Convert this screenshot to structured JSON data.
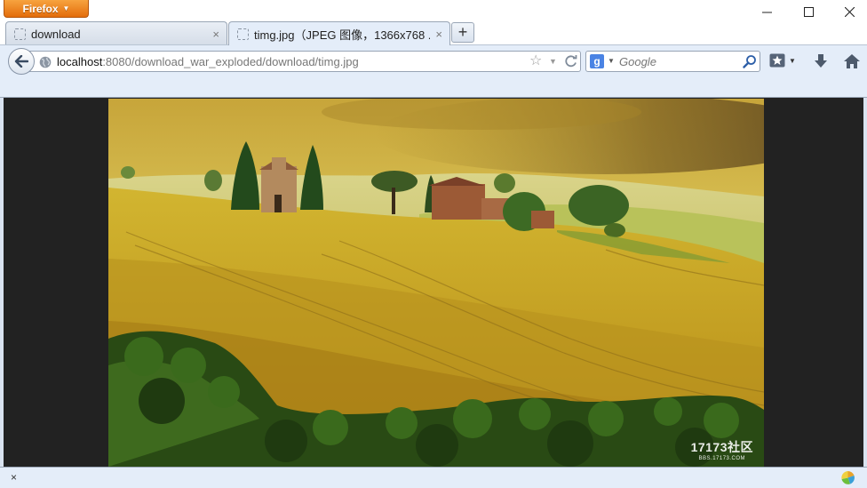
{
  "app": {
    "menu_button_label": "Firefox"
  },
  "window_controls": {
    "minimize": "—",
    "maximize": "☐",
    "close": "✕"
  },
  "tabs": [
    {
      "label": "download",
      "close": "×",
      "active": false
    },
    {
      "label": "timg.jpg（JPEG 图像，1366x768 ...",
      "close": "×",
      "active": true
    }
  ],
  "new_tab_label": "+",
  "navigation": {
    "url_host": "localhost",
    "url_rest": ":8080/download_war_exploded/download/timg.jpg",
    "search_placeholder": "Google",
    "search_engine_letter": "g"
  },
  "content": {
    "image_type": "landscape-photo",
    "watermark_main": "17173社区",
    "watermark_sub": "BBS.17173.COM"
  },
  "addon_bar": {
    "close_label": "×"
  },
  "colors": {
    "chrome_bg": "#e4edf9",
    "content_bg": "#222222",
    "firefox_orange": "#e36d0b"
  }
}
